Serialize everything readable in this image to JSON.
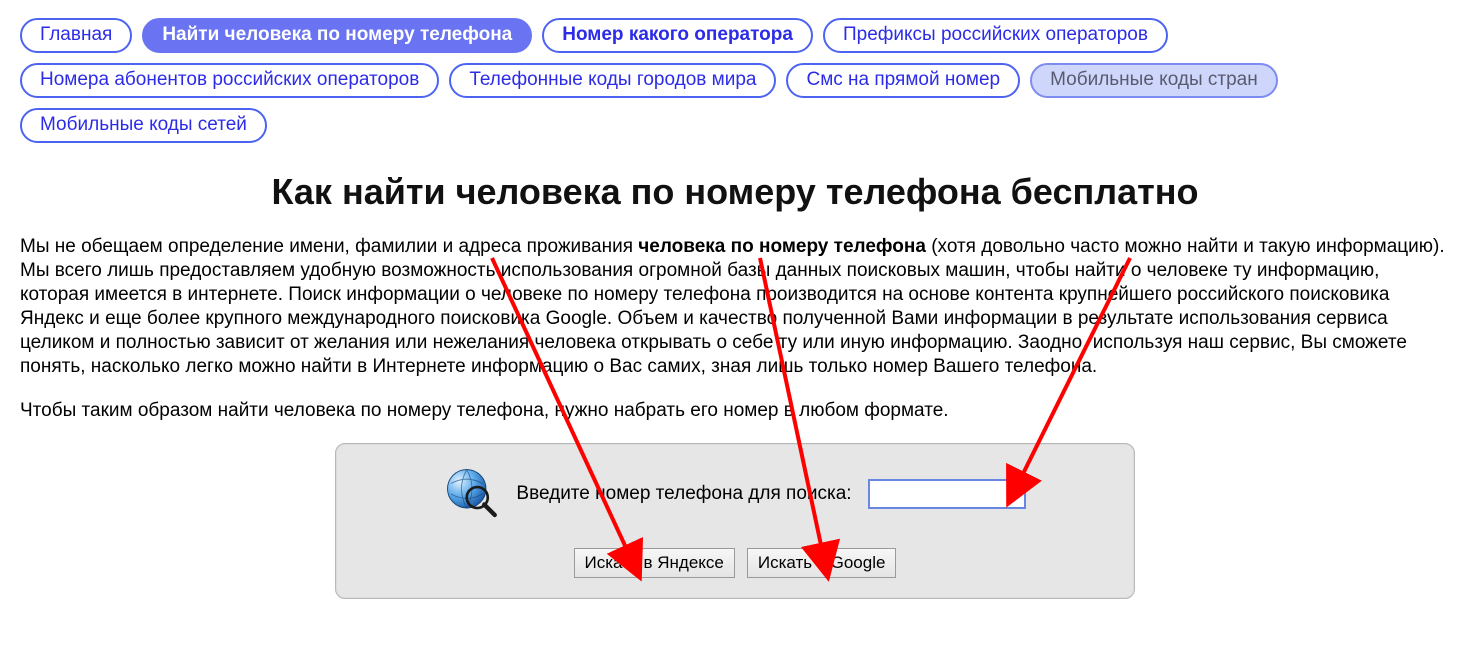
{
  "nav": {
    "items": [
      {
        "label": "Главная",
        "state": "normal"
      },
      {
        "label": "Найти человека по номеру телефона",
        "state": "active"
      },
      {
        "label": "Номер какого оператора",
        "state": "bold"
      },
      {
        "label": "Префиксы российских операторов",
        "state": "normal"
      },
      {
        "label": "Номера абонентов российских операторов",
        "state": "normal"
      },
      {
        "label": "Телефонные коды городов мира",
        "state": "normal"
      },
      {
        "label": "Смс на прямой номер",
        "state": "normal"
      },
      {
        "label": "Мобильные коды стран",
        "state": "muted"
      },
      {
        "label": "Мобильные коды сетей",
        "state": "normal"
      }
    ]
  },
  "heading": "Как найти человека по номеру телефона бесплатно",
  "para1_before": "Мы не обещаем определение имени, фамилии и адреса проживания ",
  "para1_bold": "человека по номеру телефона",
  "para1_after": " (хотя довольно часто можно найти и такую информацию). Мы всего лишь предоставляем удобную возможность использования огромной базы данных поисковых машин, чтобы найти о человеке ту информацию, которая имеется в интернете. Поиск информации о человеке по номеру телефона производится на основе контента крупнейшего российского поисковика Яндекс и еще более крупного международного поисковика Google. Объем и качество полученной Вами информации в результате использования сервиса целиком и полностью зависит от желания или нежелания человека открывать о себе ту или иную информацию. Заодно, используя наш сервис, Вы сможете понять, насколько легко можно найти в Интернете информацию о Вас самих, зная лишь только номер Вашего телефона.",
  "para2": "Чтобы таким образом найти человека по номеру телефона, нужно набрать его номер в любом формате.",
  "search": {
    "label": "Введите номер телефона для поиска:",
    "value": "",
    "btn_yandex": "Искать в Яндексе",
    "btn_google": "Искать в Google"
  }
}
